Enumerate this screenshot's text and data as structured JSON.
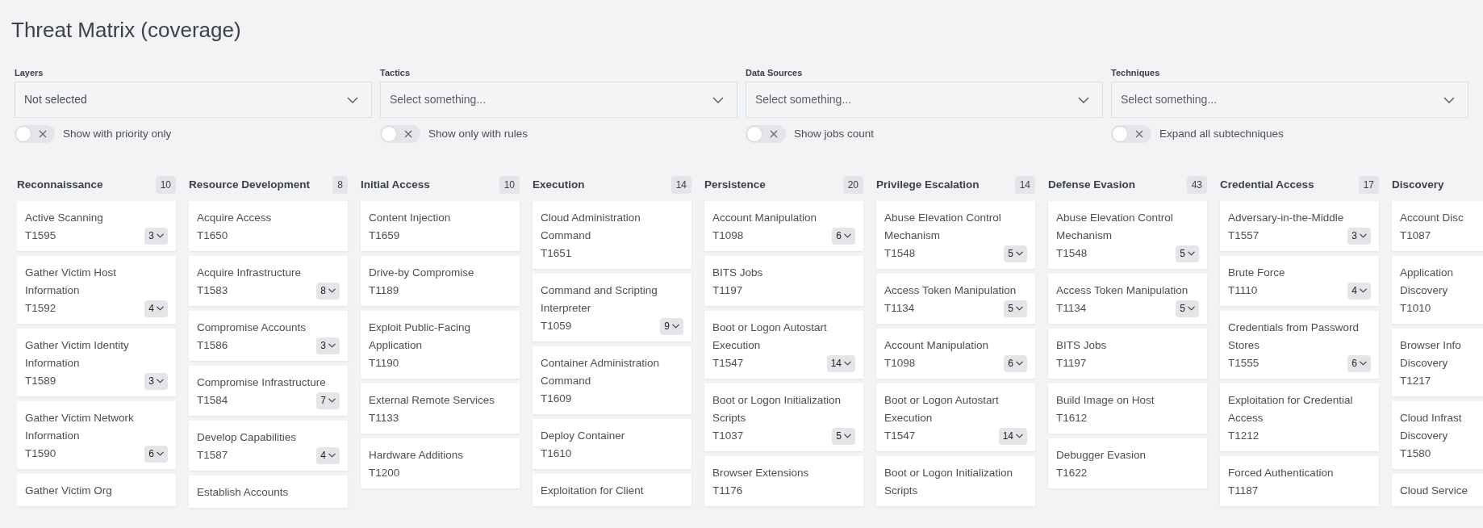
{
  "page_title": "Threat Matrix (coverage)",
  "filters": [
    {
      "label": "Layers",
      "value": "Not selected"
    },
    {
      "label": "Tactics",
      "placeholder": "Select something..."
    },
    {
      "label": "Data Sources",
      "placeholder": "Select something..."
    },
    {
      "label": "Techniques",
      "placeholder": "Select something..."
    }
  ],
  "toggles": [
    {
      "label": "Show with priority only",
      "on": false
    },
    {
      "label": "Show only with rules",
      "on": false
    },
    {
      "label": "Show jobs count",
      "on": false
    },
    {
      "label": "Expand all subtechniques",
      "on": false
    }
  ],
  "tactics": [
    {
      "name": "Reconnaissance",
      "count": "10",
      "techniques": [
        {
          "name": "Active Scanning",
          "id": "T1595",
          "subtechniques": "3"
        },
        {
          "name": "Gather Victim Host Information",
          "id": "T1592",
          "subtechniques": "4"
        },
        {
          "name": "Gather Victim Identity Information",
          "id": "T1589",
          "subtechniques": "3"
        },
        {
          "name": "Gather Victim Network Information",
          "id": "T1590",
          "subtechniques": "6"
        },
        {
          "name": "Gather Victim Org"
        }
      ]
    },
    {
      "name": "Resource Development",
      "count": "8",
      "techniques": [
        {
          "name": "Acquire Access",
          "id": "T1650"
        },
        {
          "name": "Acquire Infrastructure",
          "id": "T1583",
          "subtechniques": "8"
        },
        {
          "name": "Compromise Accounts",
          "id": "T1586",
          "subtechniques": "3"
        },
        {
          "name": "Compromise Infrastructure",
          "id": "T1584",
          "subtechniques": "7"
        },
        {
          "name": "Develop Capabilities",
          "id": "T1587",
          "subtechniques": "4"
        },
        {
          "name": "Establish Accounts"
        }
      ]
    },
    {
      "name": "Initial Access",
      "count": "10",
      "techniques": [
        {
          "name": "Content Injection",
          "id": "T1659"
        },
        {
          "name": "Drive-by Compromise",
          "id": "T1189"
        },
        {
          "name": "Exploit Public-Facing Application",
          "id": "T1190"
        },
        {
          "name": "External Remote Services",
          "id": "T1133"
        },
        {
          "name": "Hardware Additions",
          "id": "T1200"
        }
      ]
    },
    {
      "name": "Execution",
      "count": "14",
      "techniques": [
        {
          "name": "Cloud Administration Command",
          "id": "T1651"
        },
        {
          "name": "Command and Scripting Interpreter",
          "id": "T1059",
          "subtechniques": "9"
        },
        {
          "name": "Container Administration Command",
          "id": "T1609"
        },
        {
          "name": "Deploy Container",
          "id": "T1610"
        },
        {
          "name": "Exploitation for Client"
        }
      ]
    },
    {
      "name": "Persistence",
      "count": "20",
      "techniques": [
        {
          "name": "Account Manipulation",
          "id": "T1098",
          "subtechniques": "6"
        },
        {
          "name": "BITS Jobs",
          "id": "T1197"
        },
        {
          "name": "Boot or Logon Autostart Execution",
          "id": "T1547",
          "subtechniques": "14"
        },
        {
          "name": "Boot or Logon Initialization Scripts",
          "id": "T1037",
          "subtechniques": "5"
        },
        {
          "name": "Browser Extensions",
          "id": "T1176"
        }
      ]
    },
    {
      "name": "Privilege Escalation",
      "count": "14",
      "techniques": [
        {
          "name": "Abuse Elevation Control Mechanism",
          "id": "T1548",
          "subtechniques": "5"
        },
        {
          "name": "Access Token Manipulation",
          "id": "T1134",
          "subtechniques": "5"
        },
        {
          "name": "Account Manipulation",
          "id": "T1098",
          "subtechniques": "6"
        },
        {
          "name": "Boot or Logon Autostart Execution",
          "id": "T1547",
          "subtechniques": "14"
        },
        {
          "name": "Boot or Logon Initialization Scripts"
        }
      ]
    },
    {
      "name": "Defense Evasion",
      "count": "43",
      "techniques": [
        {
          "name": "Abuse Elevation Control Mechanism",
          "id": "T1548",
          "subtechniques": "5"
        },
        {
          "name": "Access Token Manipulation",
          "id": "T1134",
          "subtechniques": "5"
        },
        {
          "name": "BITS Jobs",
          "id": "T1197"
        },
        {
          "name": "Build Image on Host",
          "id": "T1612"
        },
        {
          "name": "Debugger Evasion",
          "id": "T1622"
        }
      ]
    },
    {
      "name": "Credential Access",
      "count": "17",
      "techniques": [
        {
          "name": "Adversary-in-the-Middle",
          "id": "T1557",
          "subtechniques": "3"
        },
        {
          "name": "Brute Force",
          "id": "T1110",
          "subtechniques": "4"
        },
        {
          "name": "Credentials from Password Stores",
          "id": "T1555",
          "subtechniques": "6"
        },
        {
          "name": "Exploitation for Credential Access",
          "id": "T1212"
        },
        {
          "name": "Forced Authentication",
          "id": "T1187"
        }
      ]
    },
    {
      "name": "Discovery",
      "techniques": [
        {
          "name": "Account Disc",
          "id": "T1087"
        },
        {
          "name": "Application Discovery",
          "id": "T1010"
        },
        {
          "name": "Browser Info Discovery",
          "id": "T1217"
        },
        {
          "name": "Cloud Infrast Discovery",
          "id": "T1580"
        },
        {
          "name": "Cloud Service"
        }
      ]
    }
  ]
}
